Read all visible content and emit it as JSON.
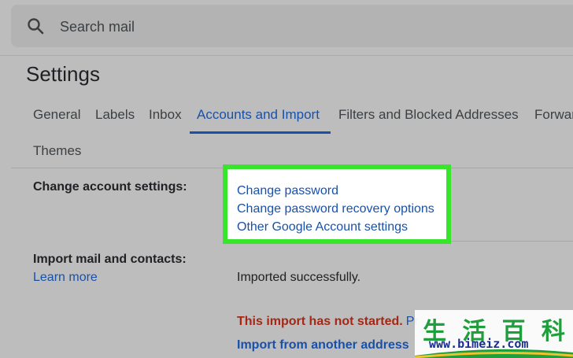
{
  "search": {
    "placeholder": "Search mail",
    "icon": "search-icon"
  },
  "page": {
    "title": "Settings"
  },
  "tabs": [
    {
      "label": "General"
    },
    {
      "label": "Labels"
    },
    {
      "label": "Inbox"
    },
    {
      "label": "Accounts and Import",
      "active": true
    },
    {
      "label": "Filters and Blocked Addresses"
    },
    {
      "label": "Forwar"
    },
    {
      "label": "Themes"
    }
  ],
  "sections": {
    "change_account": {
      "label": "Change account settings:",
      "links": [
        "Change password",
        "Change password recovery options",
        "Other Google Account settings"
      ]
    },
    "import": {
      "label": "Import mail and contacts:",
      "learn_more": "Learn more",
      "status": "Imported successfully.",
      "error": "This import has not started.",
      "error_link": "Pr",
      "import_link": "Import from another address"
    }
  },
  "watermark": {
    "chars": [
      "生",
      "活",
      "百",
      "科"
    ],
    "url": "www.bimeiz.com"
  },
  "colors": {
    "accent": "#1a51a8",
    "highlight": "#37e52a",
    "error": "#a52714",
    "background": "#bdbdbd"
  }
}
